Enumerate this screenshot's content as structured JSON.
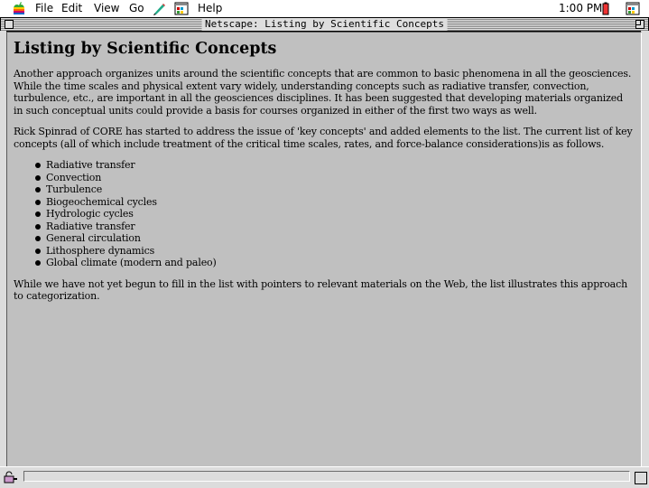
{
  "menubar": {
    "items": [
      "File",
      "Edit",
      "View",
      "Go",
      "Help"
    ],
    "clock": "1:00 PM"
  },
  "window": {
    "title": "Netscape: Listing by Scientific Concepts"
  },
  "page": {
    "heading": "Listing by Scientific Concepts",
    "para1": "Another approach organizes units around the scientific concepts that are common to basic phenomena in all the geosciences. While the time scales and physical extent vary widely, understanding concepts such as radiative transfer, convection, turbulence, etc., are important in all the geosciences disciplines. It has been suggested that developing materials organized in such conceptual units could provide a basis for courses organized in either of the first two ways as well.",
    "para2": "Rick Spinrad of CORE has started to address the issue of 'key concepts' and added elements to the list. The current list of key concepts (all of which include treatment of the critical time scales, rates, and force-balance considerations)is as follows.",
    "concepts": [
      "Radiative transfer",
      "Convection",
      "Turbulence",
      "Biogeochemical cycles",
      "Hydrologic cycles",
      "Radiative transfer",
      "General circulation",
      "Lithosphere dynamics",
      "Global climate (modern and paleo)"
    ],
    "para3": "While we have not yet begun to fill in the list with pointers to relevant materials on the Web, the list illustrates this approach to categorization."
  }
}
